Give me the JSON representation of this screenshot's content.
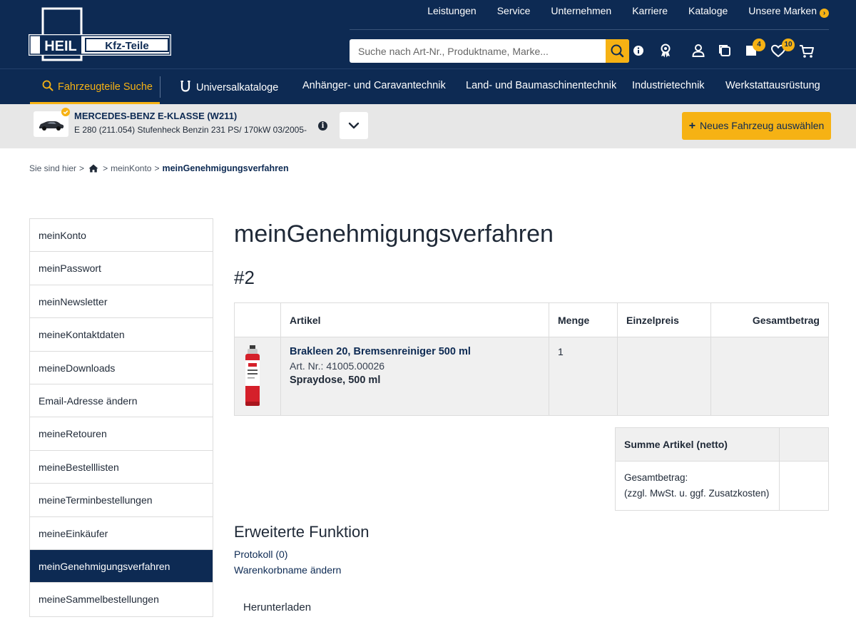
{
  "header": {
    "logo_left": "HEIL",
    "logo_right": "Kfz-Teile",
    "topnav": [
      "Leistungen",
      "Service",
      "Unternehmen",
      "Karriere",
      "Kataloge",
      "Unsere Marken"
    ],
    "search_placeholder": "Suche nach Art-Nr., Produktname, Marke...",
    "icons": [
      "search-icon",
      "info-icon",
      "award-icon",
      "user-icon",
      "copy-icon",
      "notes-icon",
      "heart-icon",
      "cart-icon"
    ],
    "notes_badge": "4",
    "wishlist_badge": "10"
  },
  "categories": [
    "Fahrzeugteile Suche",
    "Universalkataloge",
    "Anhänger- und Caravantechnik",
    "Land- und Baumaschinentechnik",
    "Industrietechnik",
    "Werkstattausrüstung"
  ],
  "vehicle": {
    "title": "MERCEDES-BENZ E-KLASSE (W211)",
    "subtitle": "E 280 (211.054) Stufenheck Benzin 231 PS/ 170kW 03/2005-",
    "new_vehicle_label": "Neues Fahrzeug auswählen"
  },
  "breadcrumb": {
    "prefix": "Sie sind hier",
    "items": [
      "meinKonto"
    ],
    "current": "meinGenehmigungsverfahren"
  },
  "sidebar": {
    "items": [
      "meinKonto",
      "meinPasswort",
      "meinNewsletter",
      "meineKontaktdaten",
      "meineDownloads",
      "Email-Adresse ändern",
      "meineRetouren",
      "meineBestelllisten",
      "meineTerminbestellungen",
      "meineEinkäufer",
      "meinGenehmigungsverfahren",
      "meineSammelbestellungen"
    ],
    "active_index": 10
  },
  "main": {
    "title": "meinGenehmigungsverfahren",
    "order_number": "#2",
    "table": {
      "headers": [
        "",
        "Artikel",
        "Menge",
        "Einzelpreis",
        "Gesamtbetrag"
      ],
      "rows": [
        {
          "name": "Brakleen 20, Bremsenreiniger 500 ml",
          "art_nr": "Art. Nr.: 41005.00026",
          "pack": "Spraydose, 500 ml",
          "qty": "1",
          "unit_price": "",
          "total": ""
        }
      ]
    },
    "summary": {
      "label": "Summe Artikel (netto)",
      "total_label": "Gesamtbetrag:",
      "total_note": "(zzgl. MwSt. u. ggf. Zusatzkosten)",
      "value": "",
      "total_value": ""
    },
    "extended_title": "Erweiterte Funktion",
    "protocol_link": "Protokoll (0)",
    "rename_link": "Warenkorbname ändern",
    "download_label": "Herunterladen"
  },
  "colors": {
    "navy": "#0d2a53",
    "accent": "#f6b214",
    "vehicle_bar": "#e7e7e7"
  }
}
